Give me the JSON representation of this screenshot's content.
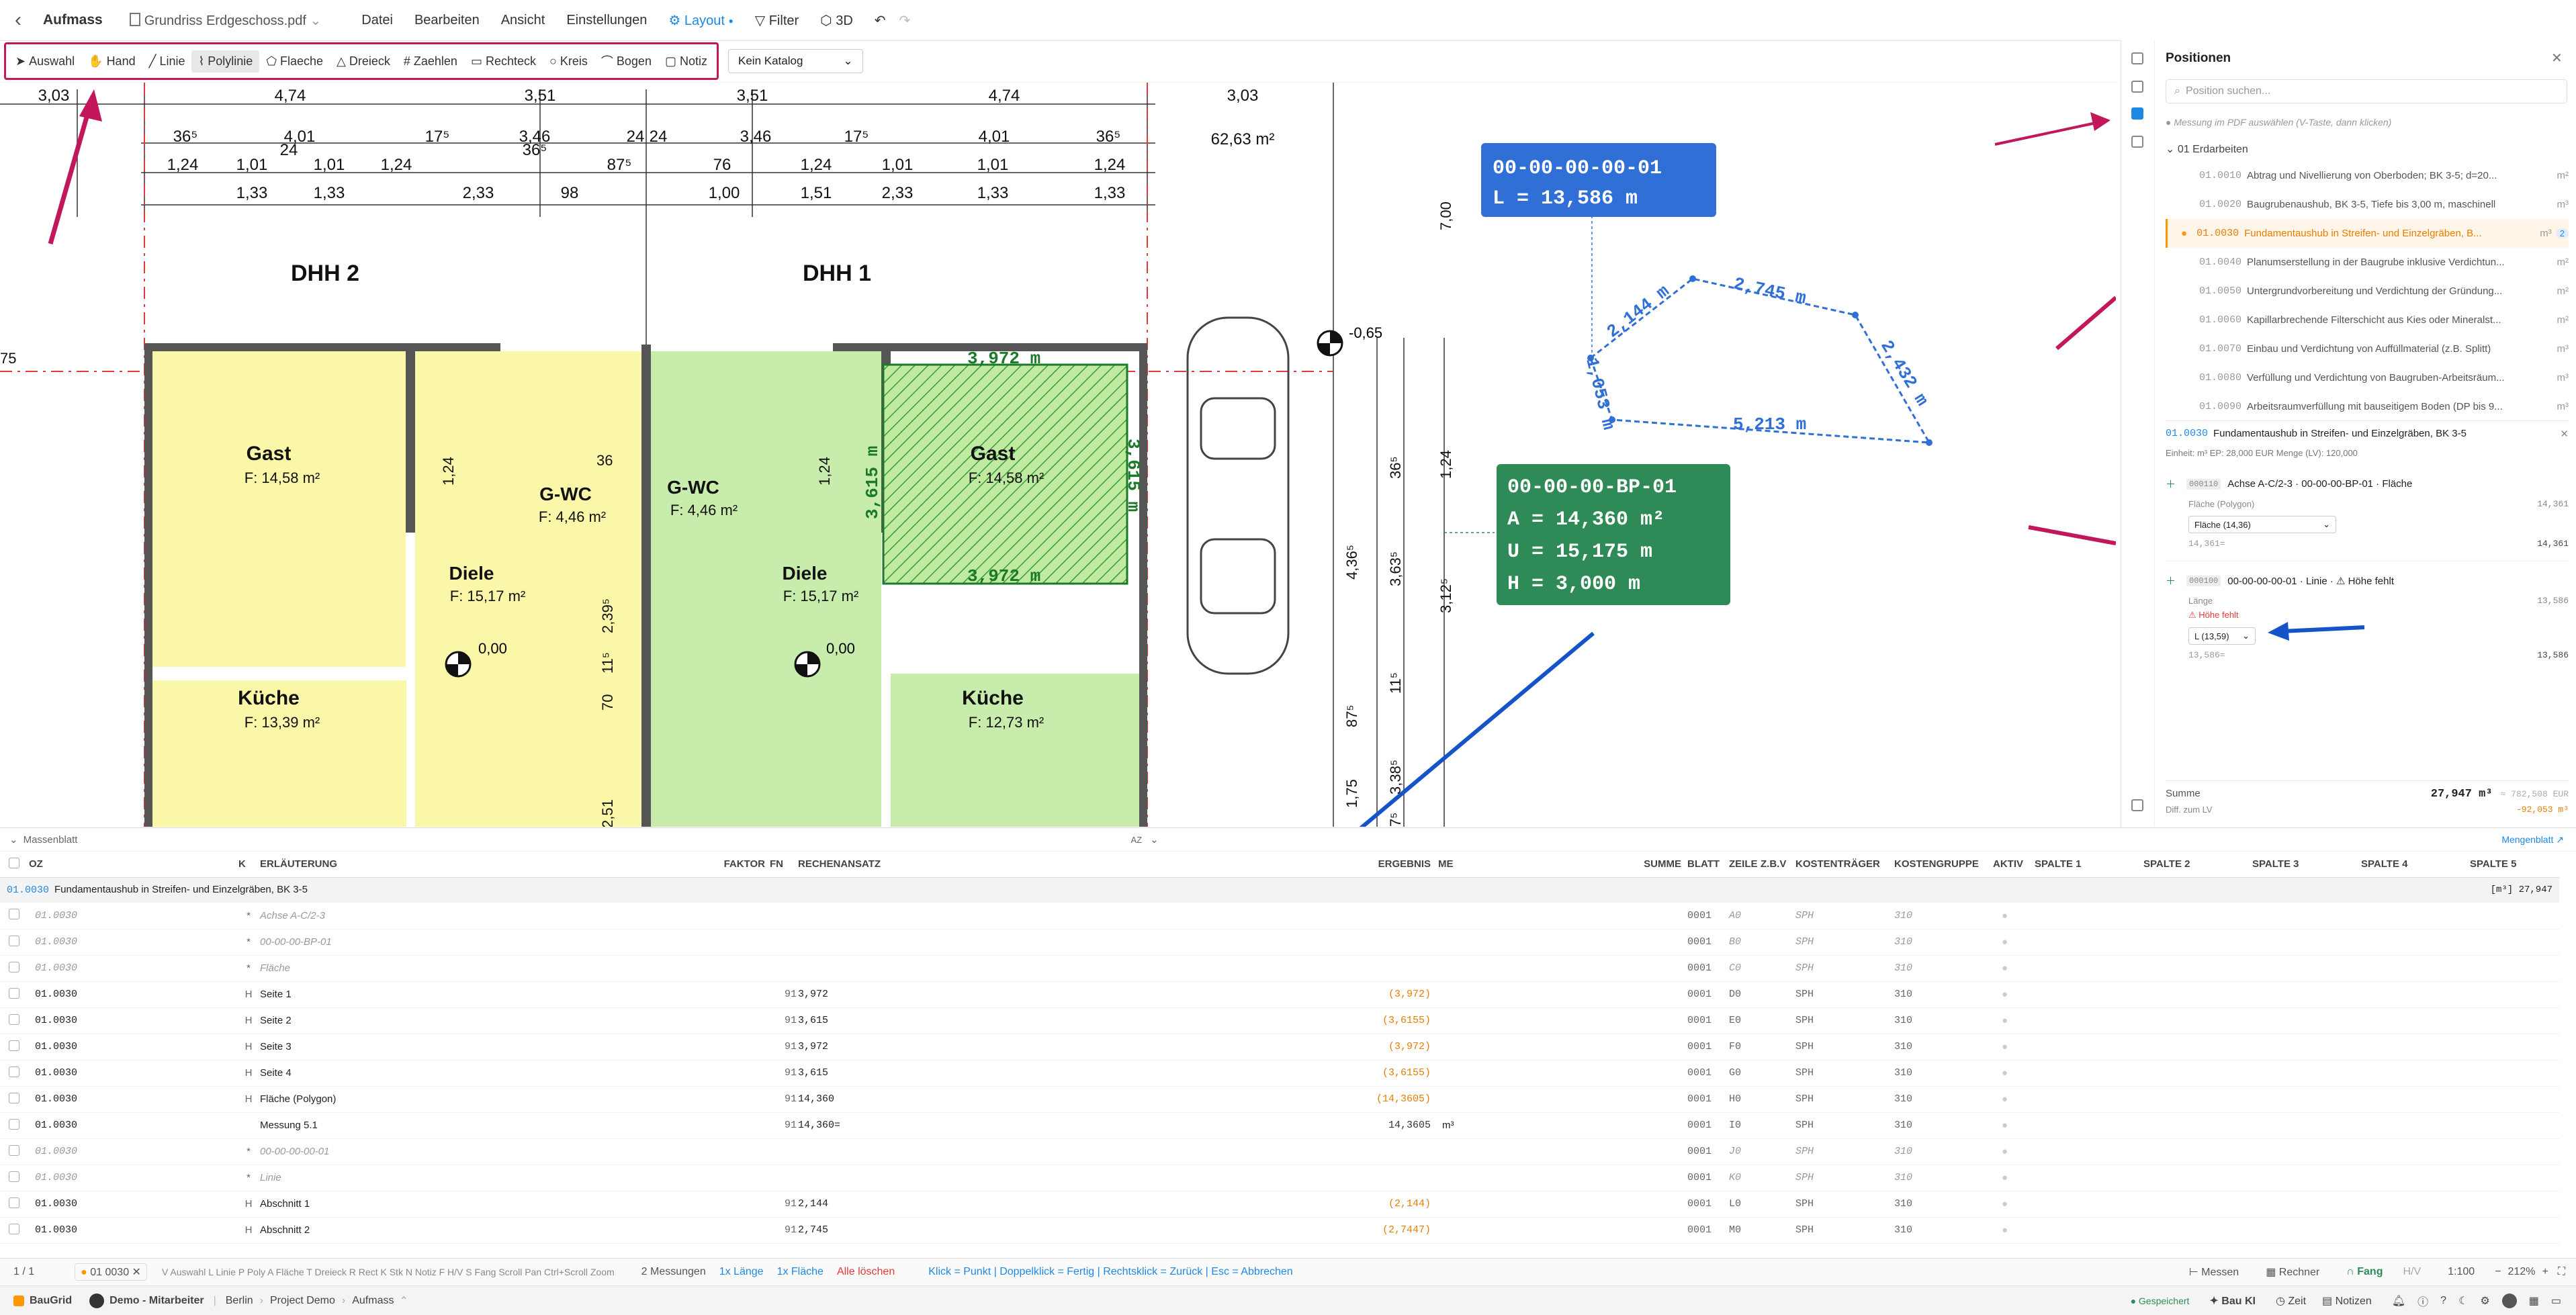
{
  "topbar": {
    "back": "‹",
    "module": "Aufmass",
    "file": "Grundriss Erdgeschoss.pdf",
    "menus": [
      "Datei",
      "Bearbeiten",
      "Ansicht",
      "Einstellungen"
    ],
    "layout": "Layout",
    "filter": "Filter",
    "view3d": "3D"
  },
  "tools": [
    {
      "label": "Auswahl",
      "icon": "cursor-icon"
    },
    {
      "label": "Hand",
      "icon": "hand-icon"
    },
    {
      "label": "Linie",
      "icon": "line-icon"
    },
    {
      "label": "Polylinie",
      "icon": "polyline-icon",
      "active": true
    },
    {
      "label": "Flaeche",
      "icon": "pentagon-icon"
    },
    {
      "label": "Dreieck",
      "icon": "triangle-icon"
    },
    {
      "label": "Zaehlen",
      "icon": "hash-icon"
    },
    {
      "label": "Rechteck",
      "icon": "rectangle-icon"
    },
    {
      "label": "Kreis",
      "icon": "circle-icon"
    },
    {
      "label": "Bogen",
      "icon": "arc-icon"
    },
    {
      "label": "Notiz",
      "icon": "note-icon"
    }
  ],
  "katalog": "Kein Katalog",
  "plan": {
    "dims_top": [
      "3,03",
      "4,74",
      "3,51",
      "3,51",
      "4,74",
      "3,03"
    ],
    "dims_row2": [
      "36⁵",
      "4,01",
      "17⁵",
      "3,46",
      "24",
      "24",
      "3,46",
      "17⁵",
      "4,01",
      "36⁵"
    ],
    "dims_row3": [
      "1,24",
      "1,01",
      "24",
      "1,01",
      "1,24",
      "36⁵",
      "1,24",
      "1,01",
      "1,01",
      "1,24"
    ],
    "dims_row3b": [
      "1,33",
      "1,33",
      "2,33",
      "98",
      "87⁵",
      "76",
      "1,00",
      "1,51",
      "2,33",
      "1,33",
      "1,33"
    ],
    "area_top": "62,63 m²",
    "house_left": "DHH 2",
    "house_right": "DHH 1",
    "rooms": [
      {
        "name": "Gast",
        "area": "F: 14,58 m²"
      },
      {
        "name": "G-WC",
        "area": "F: 4,46 m²"
      },
      {
        "name": "Diele",
        "area": "F: 15,17 m²"
      },
      {
        "name": "Küche",
        "area": "F: 13,39 m²"
      },
      {
        "name": "G-WC",
        "area": "F: 4,46 m²"
      },
      {
        "name": "Diele",
        "area": "F: 15,17 m²"
      },
      {
        "name": "Gast",
        "area": "F: 14,58 m²"
      },
      {
        "name": "Küche",
        "area": "F: 12,73 m²"
      }
    ],
    "levels": [
      "0,00",
      "0,00",
      "-0,65"
    ],
    "rect_dims": [
      "3,972 m",
      "3,615 m",
      "3,615 m",
      "3,972 m"
    ],
    "right_dims": [
      "7,00",
      "1,24",
      "36⁵",
      "4,36⁵",
      "3,63⁵",
      "3,12⁵",
      "11⁵",
      "87⁵",
      "1,75",
      "3,38⁵",
      "7⁵"
    ],
    "misc_dims": [
      "1,24",
      "1,24",
      "2,39⁵",
      "11⁵",
      "70",
      "2,51",
      "36",
      "75"
    ],
    "callout_line": {
      "id": "00-00-00-00-01",
      "value": "L = 13,586 m"
    },
    "callout_area": {
      "id": "00-00-00-BP-01",
      "a": "A = 14,360 m²",
      "u": "U = 15,175 m",
      "h": "H = 3,000 m"
    },
    "poly_labels": [
      "2,144 m",
      "2,745 m",
      "2,432 m",
      "5,213 m",
      "1,053 m"
    ]
  },
  "panel": {
    "title": "Positionen",
    "search_placeholder": "Position suchen...",
    "hint": "Messung im PDF auswählen (V-Taste, dann klicken)",
    "group": "01 Erdarbeiten",
    "items": [
      {
        "code": "01.0010",
        "text": "Abtrag und Nivellierung von Oberboden; BK 3-5; d=20...",
        "unit": "m²"
      },
      {
        "code": "01.0020",
        "text": "Baugrubenaushub, BK 3-5, Tiefe bis 3,00 m, maschinell",
        "unit": "m³"
      },
      {
        "code": "01.0030",
        "text": "Fundamentaushub in Streifen- und Einzelgräben, B...",
        "unit": "m³",
        "badge": "2",
        "active": true
      },
      {
        "code": "01.0040",
        "text": "Planumserstellung in der Baugrube inklusive Verdichtun...",
        "unit": "m²"
      },
      {
        "code": "01.0050",
        "text": "Untergrundvorbereitung und Verdichtung der Gründung...",
        "unit": "m²"
      },
      {
        "code": "01.0060",
        "text": "Kapillarbrechende Filterschicht aus Kies oder Mineralst...",
        "unit": "m²"
      },
      {
        "code": "01.0070",
        "text": "Einbau und Verdichtung von Auffüllmaterial (z.B. Splitt)",
        "unit": "m³"
      },
      {
        "code": "01.0080",
        "text": "Verfüllung und Verdichtung von Baugruben-Arbeitsräum...",
        "unit": "m³"
      },
      {
        "code": "01.0090",
        "text": "Arbeitsraumverfüllung mit bauseitigem Boden (DP bis 9...",
        "unit": "m³"
      }
    ],
    "detail": {
      "code": "01.0030",
      "title": "Fundamentaushub in Streifen- und Einzelgräben, BK 3-5",
      "meta": "Einheit: m³   EP: 28,000 EUR   Menge (LV): 120,000",
      "m1": {
        "badge": "000110",
        "name": "Achse A-C/2-3 · 00-00-00-BP-01 · Fläche",
        "value": "14,361",
        "sub": "Fläche (Polygon)",
        "select": "Fläche (14,36)",
        "formula": "14,361=",
        "total": "14,361"
      },
      "m2": {
        "badge": "000100",
        "name": "00-00-00-00-01 · Linie · ⚠ Höhe fehlt",
        "value": "13,586",
        "sub": "Länge",
        "warn": "Höhe fehlt",
        "select": "L (13,59)",
        "formula": "13,586=",
        "total": "13,586"
      }
    },
    "summe_label": "Summe",
    "summe": "27,947 m³",
    "summe_eur": "≈ 782,508 EUR",
    "diff_label": "Diff. zum LV",
    "diff": "-92,053 m³"
  },
  "sheet": {
    "title": "Massenblatt",
    "sort": "AZ",
    "link": "Mengenblatt",
    "headers": [
      "OZ",
      "K",
      "ERLÄUTERUNG",
      "FAKTOR",
      "FN",
      "RECHENANSATZ",
      "ERGEBNIS",
      "ME",
      "SUMME",
      "BLATT",
      "ZEILE",
      "Z.B.V",
      "KOSTENTRÄGER",
      "KOSTENGRUPPE",
      "AKTIV",
      "SPALTE 1",
      "SPALTE 2",
      "SPALTE 3",
      "SPALTE 4",
      "SPALTE 5"
    ],
    "group_code": "01.0030",
    "group_title": "Fundamentaushub in Streifen- und Einzelgräben, BK 3-5",
    "group_sum": "[m³] 27,947",
    "rows": [
      {
        "oz": "01.0030",
        "k": "*",
        "erl": "Achse A-C/2-3",
        "fn": "",
        "ra": "",
        "erg": "",
        "me": "",
        "blatt": "0001",
        "zeile": "A0",
        "kt": "SPH",
        "kg": "310",
        "italic": true
      },
      {
        "oz": "01.0030",
        "k": "*",
        "erl": "00-00-00-BP-01",
        "fn": "",
        "ra": "",
        "erg": "",
        "me": "",
        "blatt": "0001",
        "zeile": "B0",
        "kt": "SPH",
        "kg": "310",
        "italic": true
      },
      {
        "oz": "01.0030",
        "k": "*",
        "erl": "Fläche",
        "fn": "",
        "ra": "",
        "erg": "",
        "me": "",
        "blatt": "0001",
        "zeile": "C0",
        "kt": "SPH",
        "kg": "310",
        "italic": true
      },
      {
        "oz": "01.0030",
        "k": "H",
        "erl": "Seite 1",
        "fn": "91",
        "ra": "3,972",
        "erg": "(3,972)",
        "me": "",
        "blatt": "0001",
        "zeile": "D0",
        "kt": "SPH",
        "kg": "310"
      },
      {
        "oz": "01.0030",
        "k": "H",
        "erl": "Seite 2",
        "fn": "91",
        "ra": "3,615",
        "erg": "(3,6155)",
        "me": "",
        "blatt": "0001",
        "zeile": "E0",
        "kt": "SPH",
        "kg": "310"
      },
      {
        "oz": "01.0030",
        "k": "H",
        "erl": "Seite 3",
        "fn": "91",
        "ra": "3,972",
        "erg": "(3,972)",
        "me": "",
        "blatt": "0001",
        "zeile": "F0",
        "kt": "SPH",
        "kg": "310"
      },
      {
        "oz": "01.0030",
        "k": "H",
        "erl": "Seite 4",
        "fn": "91",
        "ra": "3,615",
        "erg": "(3,6155)",
        "me": "",
        "blatt": "0001",
        "zeile": "G0",
        "kt": "SPH",
        "kg": "310"
      },
      {
        "oz": "01.0030",
        "k": "H",
        "erl": "Fläche (Polygon)",
        "fn": "91",
        "ra": "14,360",
        "erg": "(14,3605)",
        "me": "",
        "blatt": "0001",
        "zeile": "H0",
        "kt": "SPH",
        "kg": "310"
      },
      {
        "oz": "01.0030",
        "k": "",
        "erl": "Messung 5.1",
        "fn": "91",
        "ra": "14,360=",
        "erg": "14,3605",
        "me": "m³",
        "blatt": "0001",
        "zeile": "I0",
        "kt": "SPH",
        "kg": "310",
        "plain": true
      },
      {
        "oz": "01.0030",
        "k": "*",
        "erl": "00-00-00-00-01",
        "fn": "",
        "ra": "",
        "erg": "",
        "me": "",
        "blatt": "0001",
        "zeile": "J0",
        "kt": "SPH",
        "kg": "310",
        "italic": true
      },
      {
        "oz": "01.0030",
        "k": "*",
        "erl": "Linie",
        "fn": "",
        "ra": "",
        "erg": "",
        "me": "",
        "blatt": "0001",
        "zeile": "K0",
        "kt": "SPH",
        "kg": "310",
        "italic": true
      },
      {
        "oz": "01.0030",
        "k": "H",
        "erl": "Abschnitt 1",
        "fn": "91",
        "ra": "2,144",
        "erg": "(2,144)",
        "me": "",
        "blatt": "0001",
        "zeile": "L0",
        "kt": "SPH",
        "kg": "310"
      },
      {
        "oz": "01.0030",
        "k": "H",
        "erl": "Abschnitt 2",
        "fn": "91",
        "ra": "2,745",
        "erg": "(2,7447)",
        "me": "",
        "blatt": "0001",
        "zeile": "M0",
        "kt": "SPH",
        "kg": "310"
      }
    ]
  },
  "status": {
    "page": "1 / 1",
    "pos": "01 0030",
    "shortcuts": "V Auswahl  L Linie  P Poly  A Fläche  T Dreieck  R Rect  K Stk  N Notiz  F H/V  S Fang  Scroll Pan  Ctrl+Scroll Zoom",
    "count": "2 Messungen",
    "len": "1x Länge",
    "area": "1x Fläche",
    "clear": "Alle löschen",
    "help": "Klick = Punkt | Doppelklick = Fertig | Rechtsklick = Zurück | Esc = Abbrechen",
    "messen": "Messen",
    "rechner": "Rechner",
    "fang": "Fang",
    "hv": "H/V",
    "scale": "1:100",
    "zoom": "212%"
  },
  "footer": {
    "brand": "BauGrid",
    "user": "Demo - Mitarbeiter",
    "crumbs": [
      "Berlin",
      "Project Demo",
      "Aufmass"
    ],
    "saved": "Gespeichert",
    "ai": "Bau KI",
    "time": "Zeit",
    "notes": "Notizen"
  },
  "colors": {
    "accent": "#1e88e5",
    "annotation": "#c2185b",
    "arrow_blue": "#1453c8",
    "area_green": "#2e8b57",
    "line_blue": "#2f6fd6",
    "room_yellow": "#fbf7a8",
    "room_green": "#c7ecab"
  }
}
